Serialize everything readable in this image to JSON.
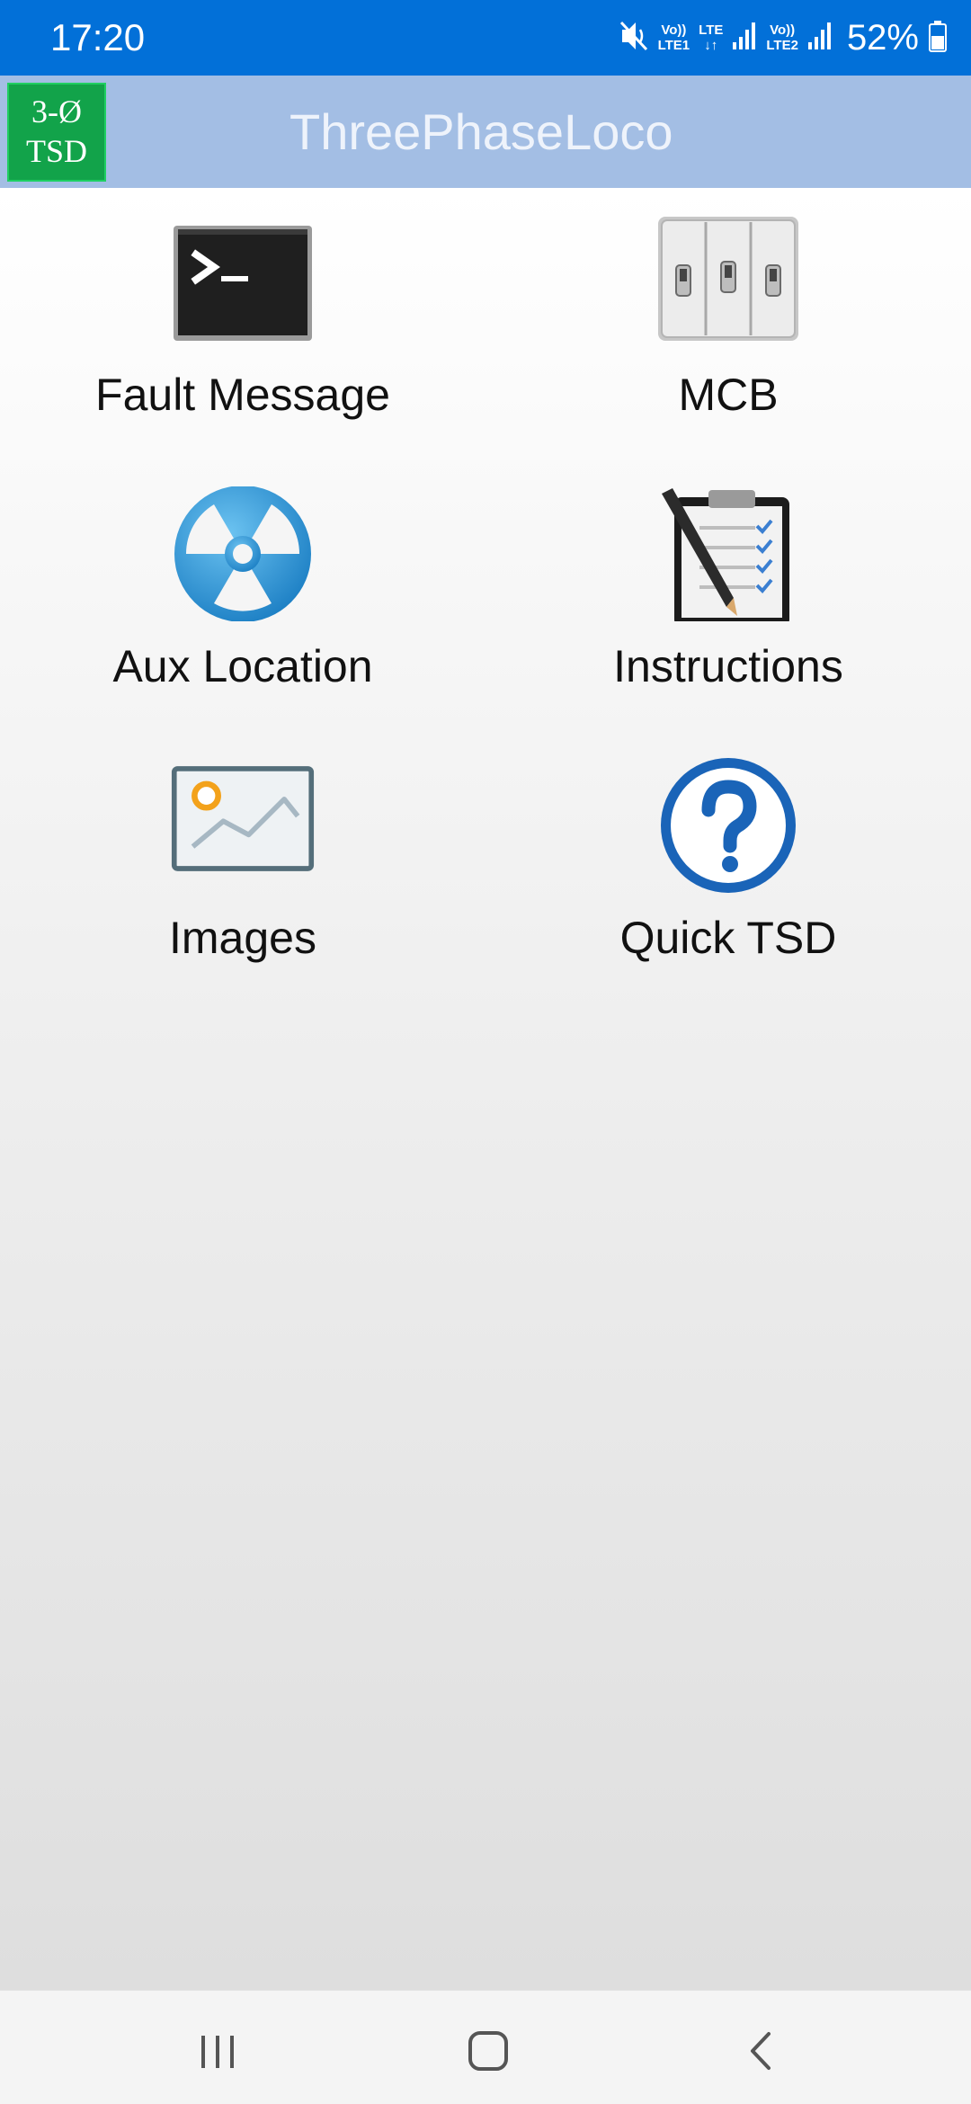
{
  "status_bar": {
    "time": "17:20",
    "sim1_top": "Vo))",
    "sim1_bottom": "LTE1",
    "data_top": "LTE",
    "data_bottom": "↓↑",
    "sim2_top": "Vo))",
    "sim2_bottom": "LTE2",
    "battery_percent": "52%",
    "icons": [
      "mute-vibrate-icon",
      "signal-icon",
      "battery-icon"
    ],
    "color": "#0270d8"
  },
  "app_bar": {
    "logo_line1": "3-Ø",
    "logo_line2": "TSD",
    "title": "ThreePhaseLoco",
    "color": "#a3bee4",
    "logo_color": "#12a34a"
  },
  "menu": {
    "items": [
      {
        "label": "Fault Message",
        "icon": "terminal-icon"
      },
      {
        "label": "MCB",
        "icon": "breaker-switch-icon"
      },
      {
        "label": "Aux Location",
        "icon": "radiation-icon"
      },
      {
        "label": "Instructions",
        "icon": "clipboard-checklist-icon"
      },
      {
        "label": "Images",
        "icon": "image-icon"
      },
      {
        "label": "Quick TSD",
        "icon": "help-icon"
      }
    ]
  },
  "nav_bar": {
    "buttons": [
      "recent-apps-icon",
      "home-icon",
      "back-icon"
    ]
  }
}
